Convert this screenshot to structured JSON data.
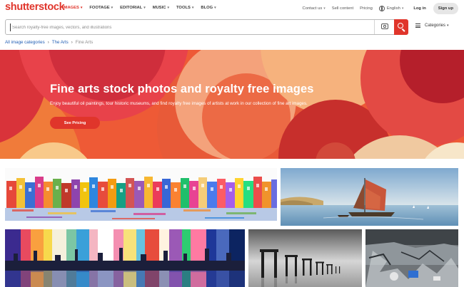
{
  "brand": {
    "logo": "shutterstock",
    "accent": "#e0352b",
    "link": "#2360b5"
  },
  "nav": {
    "items": [
      {
        "label": "IMAGES",
        "active": true
      },
      {
        "label": "FOOTAGE",
        "active": false
      },
      {
        "label": "EDITORIAL",
        "active": false
      },
      {
        "label": "MUSIC",
        "active": false
      },
      {
        "label": "TOOLS",
        "active": false
      },
      {
        "label": "BLOG",
        "active": false
      }
    ],
    "contact": "Contact us",
    "sell": "Sell content",
    "pricing": "Pricing",
    "language": "English",
    "login": "Log in",
    "signup": "Sign up"
  },
  "search": {
    "placeholder": "Search royalty-free images, vectors, and illustrations",
    "value": "",
    "camera_icon": "camera-icon",
    "search_icon": "search-icon",
    "categories_label": "Categories"
  },
  "breadcrumb": {
    "items": [
      "All image categories",
      "The Arts"
    ],
    "current": "Fine Arts"
  },
  "hero": {
    "title": "Fine arts stock photos and royalty free images",
    "subtitle": "Enjoy beautiful oil paintings, tour historic museums, and find royalty free images of artists at work in our collection of fine art images.",
    "cta": "See Pricing"
  },
  "gallery": [
    {
      "name": "colorful-harbor-town-painting"
    },
    {
      "name": "sailboat-seascape-painting"
    },
    {
      "name": "rainbow-city-skyline-painting"
    },
    {
      "name": "pier-posts-in-mist-photo"
    },
    {
      "name": "grunge-abstract-painting"
    }
  ]
}
